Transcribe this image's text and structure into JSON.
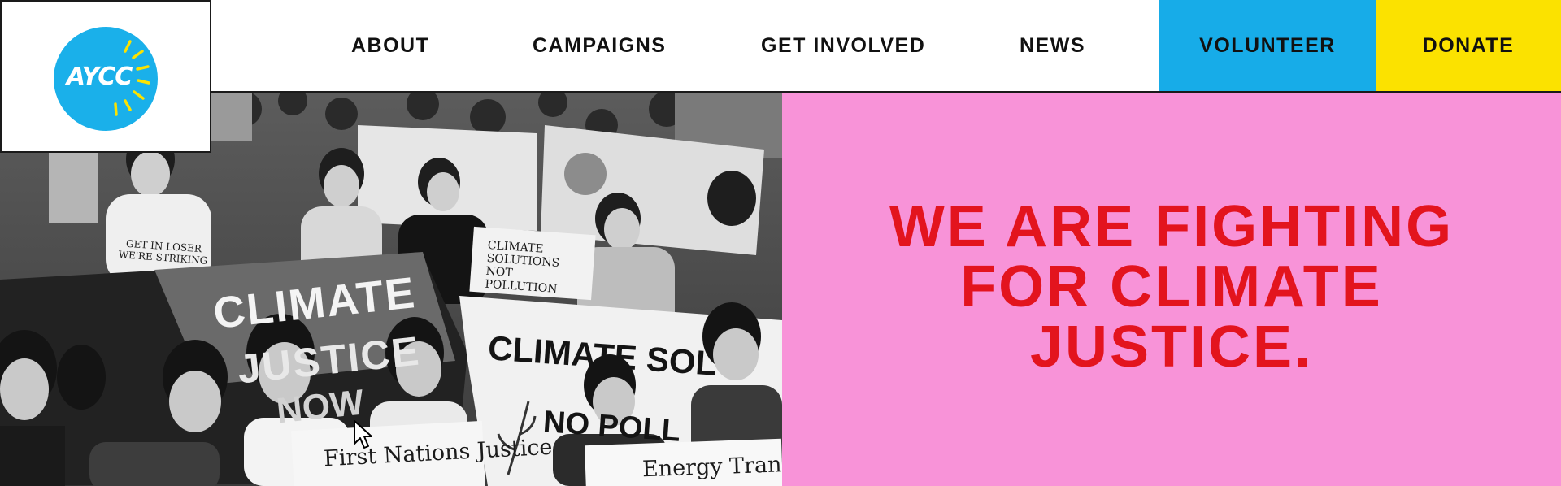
{
  "brand": {
    "logo_text": "AYCC",
    "logo_color": "#1ab0ea"
  },
  "nav": {
    "items": [
      {
        "label": "ABOUT"
      },
      {
        "label": "CAMPAIGNS"
      },
      {
        "label": "GET INVOLVED"
      },
      {
        "label": "NEWS"
      }
    ],
    "volunteer_label": "VOLUNTEER",
    "donate_label": "DONATE",
    "volunteer_color": "#17ace8",
    "donate_color": "#fbe200"
  },
  "hero": {
    "heading_lines": [
      "WE ARE FIGHTING",
      "FOR CLIMATE",
      "JUSTICE."
    ],
    "heading_color": "#e3141e",
    "panel_color": "#f893d8",
    "photo": {
      "banner_main": [
        "CLIMATE",
        "JUSTICE",
        "NOW"
      ],
      "banner_secondary": [
        "CLIMATE SOL",
        "NO POLL"
      ],
      "sign_first_nations": "First Nations Justice",
      "sign_energy": "Energy Transition",
      "shirt_text": "GET IN LOSER WE'RE STRIKING",
      "sign_small": "CLIMATE SOLUTIONS NOT POLLUTION"
    }
  }
}
